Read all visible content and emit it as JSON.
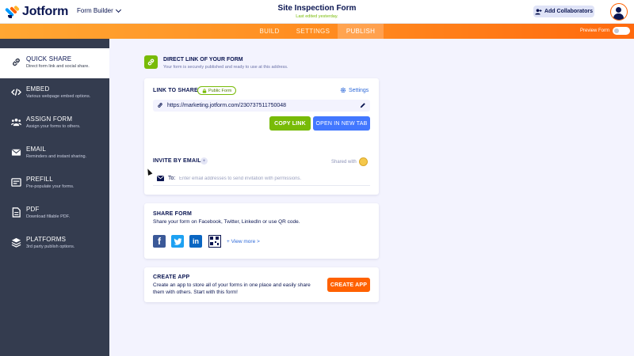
{
  "app": {
    "brand": "Jotform",
    "form_builder_label": "Form Builder"
  },
  "header": {
    "form_title": "Site Inspection Form",
    "last_edited": "Last edited yesterday.",
    "add_collaborators": "Add Collaborators"
  },
  "nav": {
    "tabs": [
      {
        "label": "BUILD",
        "active": false
      },
      {
        "label": "SETTINGS",
        "active": false
      },
      {
        "label": "PUBLISH",
        "active": true
      }
    ],
    "preview_label": "Preview Form",
    "preview_enabled": false
  },
  "sidebar": {
    "items": [
      {
        "title": "QUICK SHARE",
        "desc": "Direct form link and social share.",
        "icon": "link-icon",
        "active": true
      },
      {
        "title": "EMBED",
        "desc": "Various webpage embed options.",
        "icon": "code-icon",
        "active": false
      },
      {
        "title": "ASSIGN FORM",
        "desc": "Assign your forms to others.",
        "icon": "users-icon",
        "active": false
      },
      {
        "title": "EMAIL",
        "desc": "Reminders and instant sharing.",
        "icon": "envelope-icon",
        "active": false
      },
      {
        "title": "PREFILL",
        "desc": "Pre-populate your forms.",
        "icon": "prefill-icon",
        "active": false
      },
      {
        "title": "PDF",
        "desc": "Download fillable PDF.",
        "icon": "pdf-icon",
        "active": false
      },
      {
        "title": "PLATFORMS",
        "desc": "3rd party publish options.",
        "icon": "layers-icon",
        "active": false
      }
    ]
  },
  "direct_link": {
    "title": "DIRECT LINK OF YOUR FORM",
    "subtitle": "Your form is securely published and ready to use at this address."
  },
  "link_card": {
    "label": "LINK TO SHARE",
    "badge": "Public Form",
    "settings": "Settings",
    "url": "https://marketing.jotform.com/230737511750048",
    "copy_button": "COPY LINK",
    "open_button": "OPEN IN NEW TAB",
    "invite_label": "INVITE BY EMAIL",
    "shared_with": "Shared with",
    "to_label": "To:",
    "email_placeholder": "Enter email addresses to send invitation with permissions."
  },
  "share_card": {
    "label": "SHARE FORM",
    "description": "Share your form on Facebook, Twitter, LinkedIn or use QR code.",
    "view_more": "+ View more >"
  },
  "app_card": {
    "label": "CREATE APP",
    "description_line1": "Create an app to store all of your forms in one place and easily share",
    "description_line2": "them with others. Start with this form!",
    "button": "CREATE APP"
  },
  "colors": {
    "accent_orange": "#ff6100",
    "green": "#78bb07",
    "blue": "#4277ff",
    "navy": "#0a1551",
    "sidebar_bg": "#343c4f"
  }
}
